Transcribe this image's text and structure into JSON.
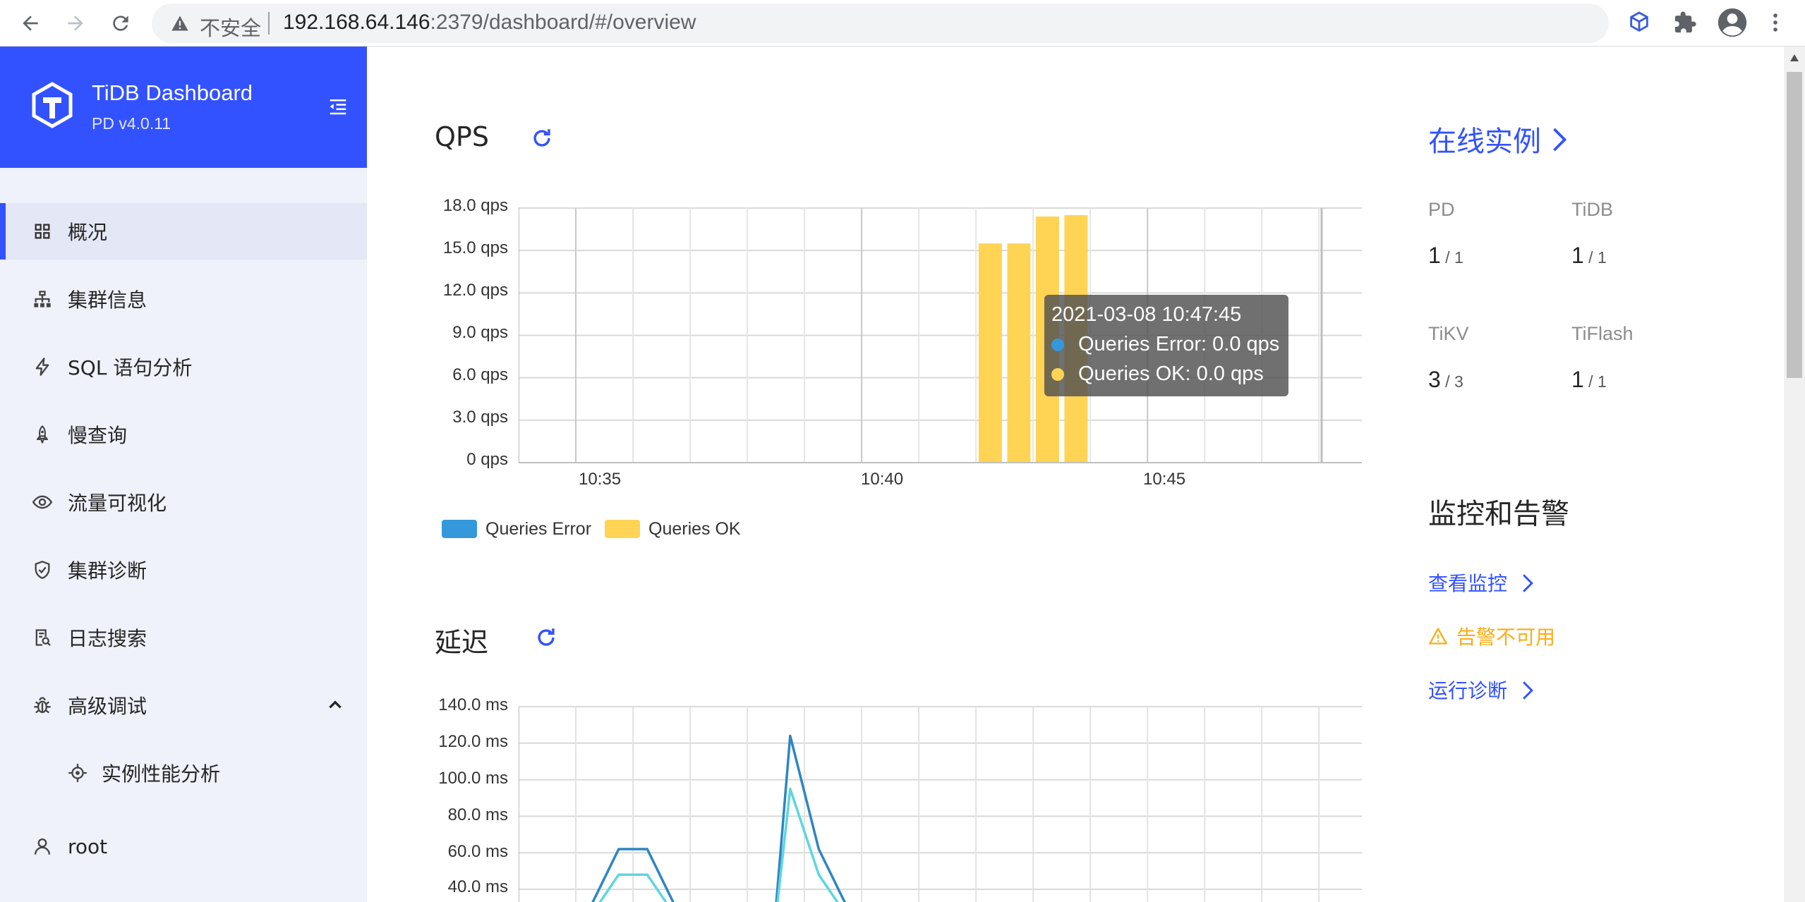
{
  "browser": {
    "insecure_label": "不安全",
    "url_host": "192.168.64.146",
    "url_rest": ":2379/dashboard/#/overview"
  },
  "sidebar": {
    "app_name": "TiDB Dashboard",
    "version": "PD v4.0.11",
    "items": [
      {
        "label": "概况",
        "icon": "dashboard-grid-icon",
        "active": true
      },
      {
        "label": "集群信息",
        "icon": "cluster-icon"
      },
      {
        "label": "SQL 语句分析",
        "icon": "lightning-icon"
      },
      {
        "label": "慢查询",
        "icon": "rocket-icon"
      },
      {
        "label": "流量可视化",
        "icon": "eye-icon"
      },
      {
        "label": "集群诊断",
        "icon": "shield-check-icon"
      },
      {
        "label": "日志搜索",
        "icon": "file-search-icon"
      },
      {
        "label": "高级调试",
        "icon": "bug-icon",
        "expanded": true
      },
      {
        "label": "实例性能分析",
        "icon": "target-icon",
        "sub": true
      }
    ],
    "user": "root"
  },
  "qps": {
    "title": "QPS",
    "tooltip": {
      "time": "2021-03-08 10:47:45",
      "error_line": "Queries Error: 0.0 qps",
      "ok_line": "Queries OK: 0.0 qps"
    },
    "legend": [
      "Queries Error",
      "Queries OK"
    ]
  },
  "latency": {
    "title": "延迟"
  },
  "chart_data": [
    {
      "type": "bar",
      "title": "QPS",
      "ylim": [
        0,
        18
      ],
      "yticks": [
        "18.0 qps",
        "15.0 qps",
        "12.0 qps",
        "9.0 qps",
        "6.0 qps",
        "3.0 qps",
        "0 qps"
      ],
      "xticks": [
        "10:35",
        "10:40",
        "10:45"
      ],
      "x_range": [
        "10:34",
        "10:48:45"
      ],
      "series": [
        {
          "name": "Queries Error",
          "color": "#3498db",
          "x": [
            "10:42:15",
            "10:42:45",
            "10:43:15",
            "10:43:45"
          ],
          "values": [
            0,
            0,
            0,
            0
          ]
        },
        {
          "name": "Queries OK",
          "color": "#ffd454",
          "x": [
            "10:42:15",
            "10:42:45",
            "10:43:15",
            "10:43:45"
          ],
          "values": [
            15.5,
            15.5,
            17.4,
            17.5
          ]
        }
      ]
    },
    {
      "type": "line",
      "title": "延迟",
      "ylim": [
        40,
        140
      ],
      "yticks": [
        "140.0 ms",
        "120.0 ms",
        "100.0 ms",
        "80.0 ms",
        "60.0 ms",
        "40.0 ms"
      ],
      "x_range": [
        "10:34",
        "10:48:45"
      ],
      "series": [
        {
          "color": "#2e86c1",
          "x": [
            "10:35:15",
            "10:35:45",
            "10:36:15",
            "10:36:45",
            "10:38:30",
            "10:38:45",
            "10:39:15",
            "10:39:45"
          ],
          "values": [
            30,
            62,
            62,
            30,
            30,
            124,
            62,
            30
          ]
        },
        {
          "color": "#5dd6e0",
          "x": [
            "10:35:15",
            "10:35:45",
            "10:36:15",
            "10:36:45",
            "10:38:30",
            "10:38:45",
            "10:39:15",
            "10:39:45"
          ],
          "values": [
            25,
            48,
            48,
            25,
            25,
            95,
            48,
            25
          ]
        }
      ]
    }
  ],
  "instances": {
    "title": "在线实例",
    "items": [
      {
        "name": "PD",
        "up": "1",
        "total": " / 1"
      },
      {
        "name": "TiDB",
        "up": "1",
        "total": " / 1"
      },
      {
        "name": "TiKV",
        "up": "3",
        "total": " / 3"
      },
      {
        "name": "TiFlash",
        "up": "1",
        "total": " / 1"
      }
    ]
  },
  "monitoring": {
    "title": "监控和告警",
    "view_metrics": "查看监控",
    "alert_unavailable": "告警不可用",
    "run_diagnosis": "运行诊断"
  }
}
